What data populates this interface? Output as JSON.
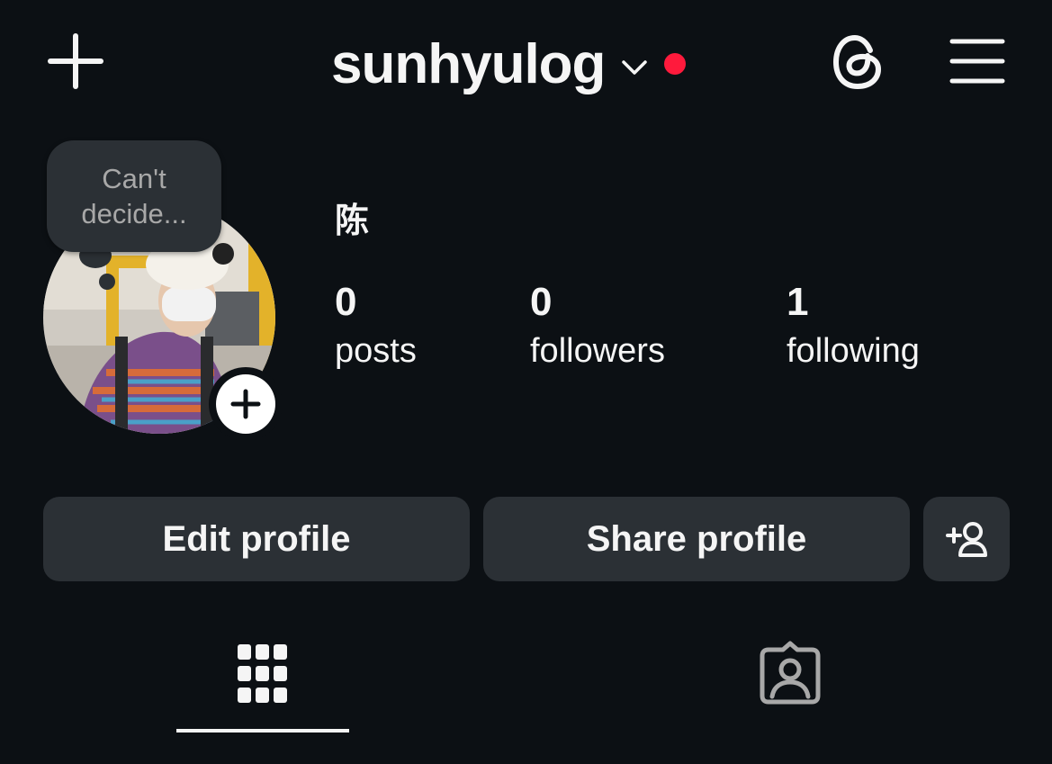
{
  "header": {
    "username": "sunhyulog",
    "create_icon": "plus-icon",
    "dropdown_icon": "chevron-down-icon",
    "notification_dot_color": "#ff1a3c",
    "threads_icon": "threads-icon",
    "menu_icon": "hamburger-menu-icon"
  },
  "profile": {
    "note_bubble": "Can't decide...",
    "display_name": "陈",
    "add_story_icon": "plus-icon"
  },
  "stats": [
    {
      "count": "0",
      "label": "posts"
    },
    {
      "count": "0",
      "label": "followers"
    },
    {
      "count": "1",
      "label": "following"
    }
  ],
  "buttons": {
    "edit_profile": "Edit profile",
    "share_profile": "Share profile",
    "discover_people_icon": "add-person-icon"
  },
  "tabs": [
    {
      "icon": "grid-icon",
      "active": true
    },
    {
      "icon": "tagged-icon",
      "active": false
    }
  ],
  "colors": {
    "background": "#0c1014",
    "button_bg": "#2b3035",
    "text": "#f5f5f5",
    "muted_text": "#a8a8a8"
  }
}
